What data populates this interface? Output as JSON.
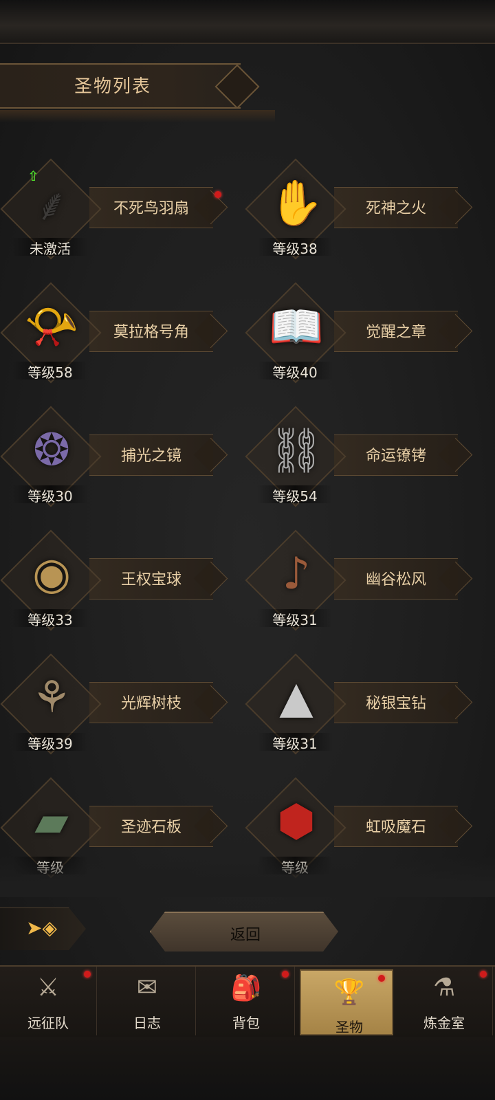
{
  "header": {
    "title": "圣物列表"
  },
  "relics": [
    {
      "name": "不死鸟羽扇",
      "level": "未激活",
      "icon": "feather-fan-icon",
      "glyph": "⸙",
      "color": "#3c3a38",
      "red_dot": true,
      "upgrade": true
    },
    {
      "name": "死神之火",
      "level": "等级38",
      "icon": "spectral-hand-icon",
      "glyph": "✋",
      "color": "#8fb8e6",
      "red_dot": false,
      "upgrade": false
    },
    {
      "name": "莫拉格号角",
      "level": "等级58",
      "icon": "horn-icon",
      "glyph": "📯",
      "color": "#7a6a55",
      "red_dot": false,
      "upgrade": false
    },
    {
      "name": "觉醒之章",
      "level": "等级40",
      "icon": "tome-icon",
      "glyph": "📖",
      "color": "#b08a52",
      "red_dot": false,
      "upgrade": false
    },
    {
      "name": "捕光之镜",
      "level": "等级30",
      "icon": "mirror-icon",
      "glyph": "❂",
      "color": "#7b6aa8",
      "red_dot": false,
      "upgrade": false
    },
    {
      "name": "命运镣铐",
      "level": "等级54",
      "icon": "shackles-icon",
      "glyph": "⛓",
      "color": "#b0b0b0",
      "red_dot": false,
      "upgrade": false
    },
    {
      "name": "王权宝球",
      "level": "等级33",
      "icon": "orb-icon",
      "glyph": "◉",
      "color": "#b89454",
      "red_dot": false,
      "upgrade": false
    },
    {
      "name": "幽谷松风",
      "level": "等级31",
      "icon": "lute-icon",
      "glyph": "♪",
      "color": "#9a5a3a",
      "red_dot": false,
      "upgrade": false
    },
    {
      "name": "光辉树枝",
      "level": "等级39",
      "icon": "branch-icon",
      "glyph": "⚘",
      "color": "#a08a6a",
      "red_dot": false,
      "upgrade": false
    },
    {
      "name": "秘银宝钻",
      "level": "等级31",
      "icon": "pyramid-gem-icon",
      "glyph": "▲",
      "color": "#c9c9c9",
      "red_dot": false,
      "upgrade": false
    },
    {
      "name": "圣迹石板",
      "level": "等级",
      "icon": "stone-tablet-icon",
      "glyph": "▰",
      "color": "#5c7a5a",
      "red_dot": false,
      "upgrade": false
    },
    {
      "name": "虹吸魔石",
      "level": "等级",
      "icon": "red-stone-icon",
      "glyph": "⬢",
      "color": "#c0241e",
      "red_dot": false,
      "upgrade": false
    }
  ],
  "footer": {
    "back_label": "返回",
    "arrow_glyph": "➤◈"
  },
  "tabs": [
    {
      "label": "远征队",
      "glyph": "⚔",
      "icon": "helmet-icon",
      "active": false,
      "red_dot": true
    },
    {
      "label": "日志",
      "glyph": "✉",
      "icon": "scroll-map-icon",
      "active": false,
      "red_dot": false
    },
    {
      "label": "背包",
      "glyph": "🎒",
      "icon": "backpack-icon",
      "active": false,
      "red_dot": true
    },
    {
      "label": "圣物",
      "glyph": "🏆",
      "icon": "chalice-icon",
      "active": true,
      "red_dot": true
    },
    {
      "label": "炼金室",
      "glyph": "⚗",
      "icon": "alchemy-icon",
      "active": false,
      "red_dot": true
    }
  ]
}
